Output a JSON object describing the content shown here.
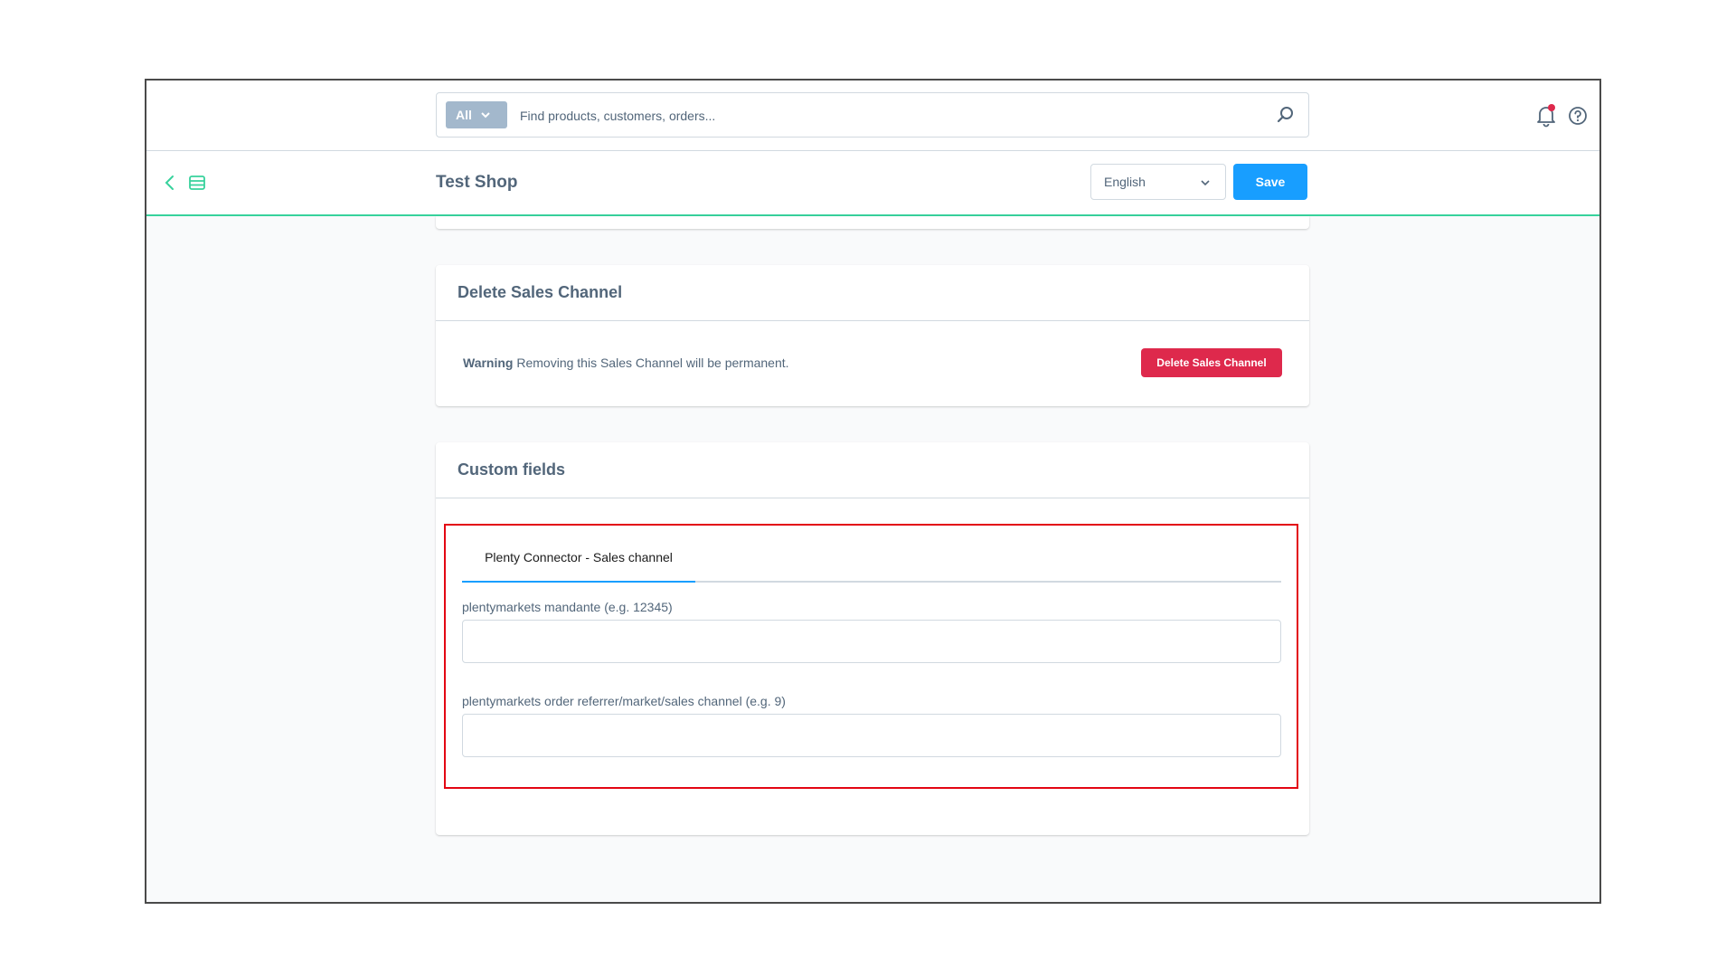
{
  "search": {
    "type_label": "All",
    "placeholder": "Find products, customers, orders..."
  },
  "smartbar": {
    "title": "Test Shop",
    "language": "English",
    "save_label": "Save"
  },
  "delete_card": {
    "title": "Delete Sales Channel",
    "warning_label": "Warning",
    "warning_text": "Removing this Sales Channel will be permanent.",
    "button_label": "Delete Sales Channel"
  },
  "custom_fields": {
    "title": "Custom fields",
    "tab_label": "Plenty Connector - Sales channel",
    "fields": [
      {
        "label": "plentymarkets mandante (e.g. 12345)",
        "value": ""
      },
      {
        "label": "plentymarkets order referrer/market/sales channel (e.g. 9)",
        "value": ""
      }
    ]
  },
  "colors": {
    "primary": "#189eff",
    "danger": "#de294c",
    "accent": "#37d29c",
    "highlight": "#e30613"
  }
}
